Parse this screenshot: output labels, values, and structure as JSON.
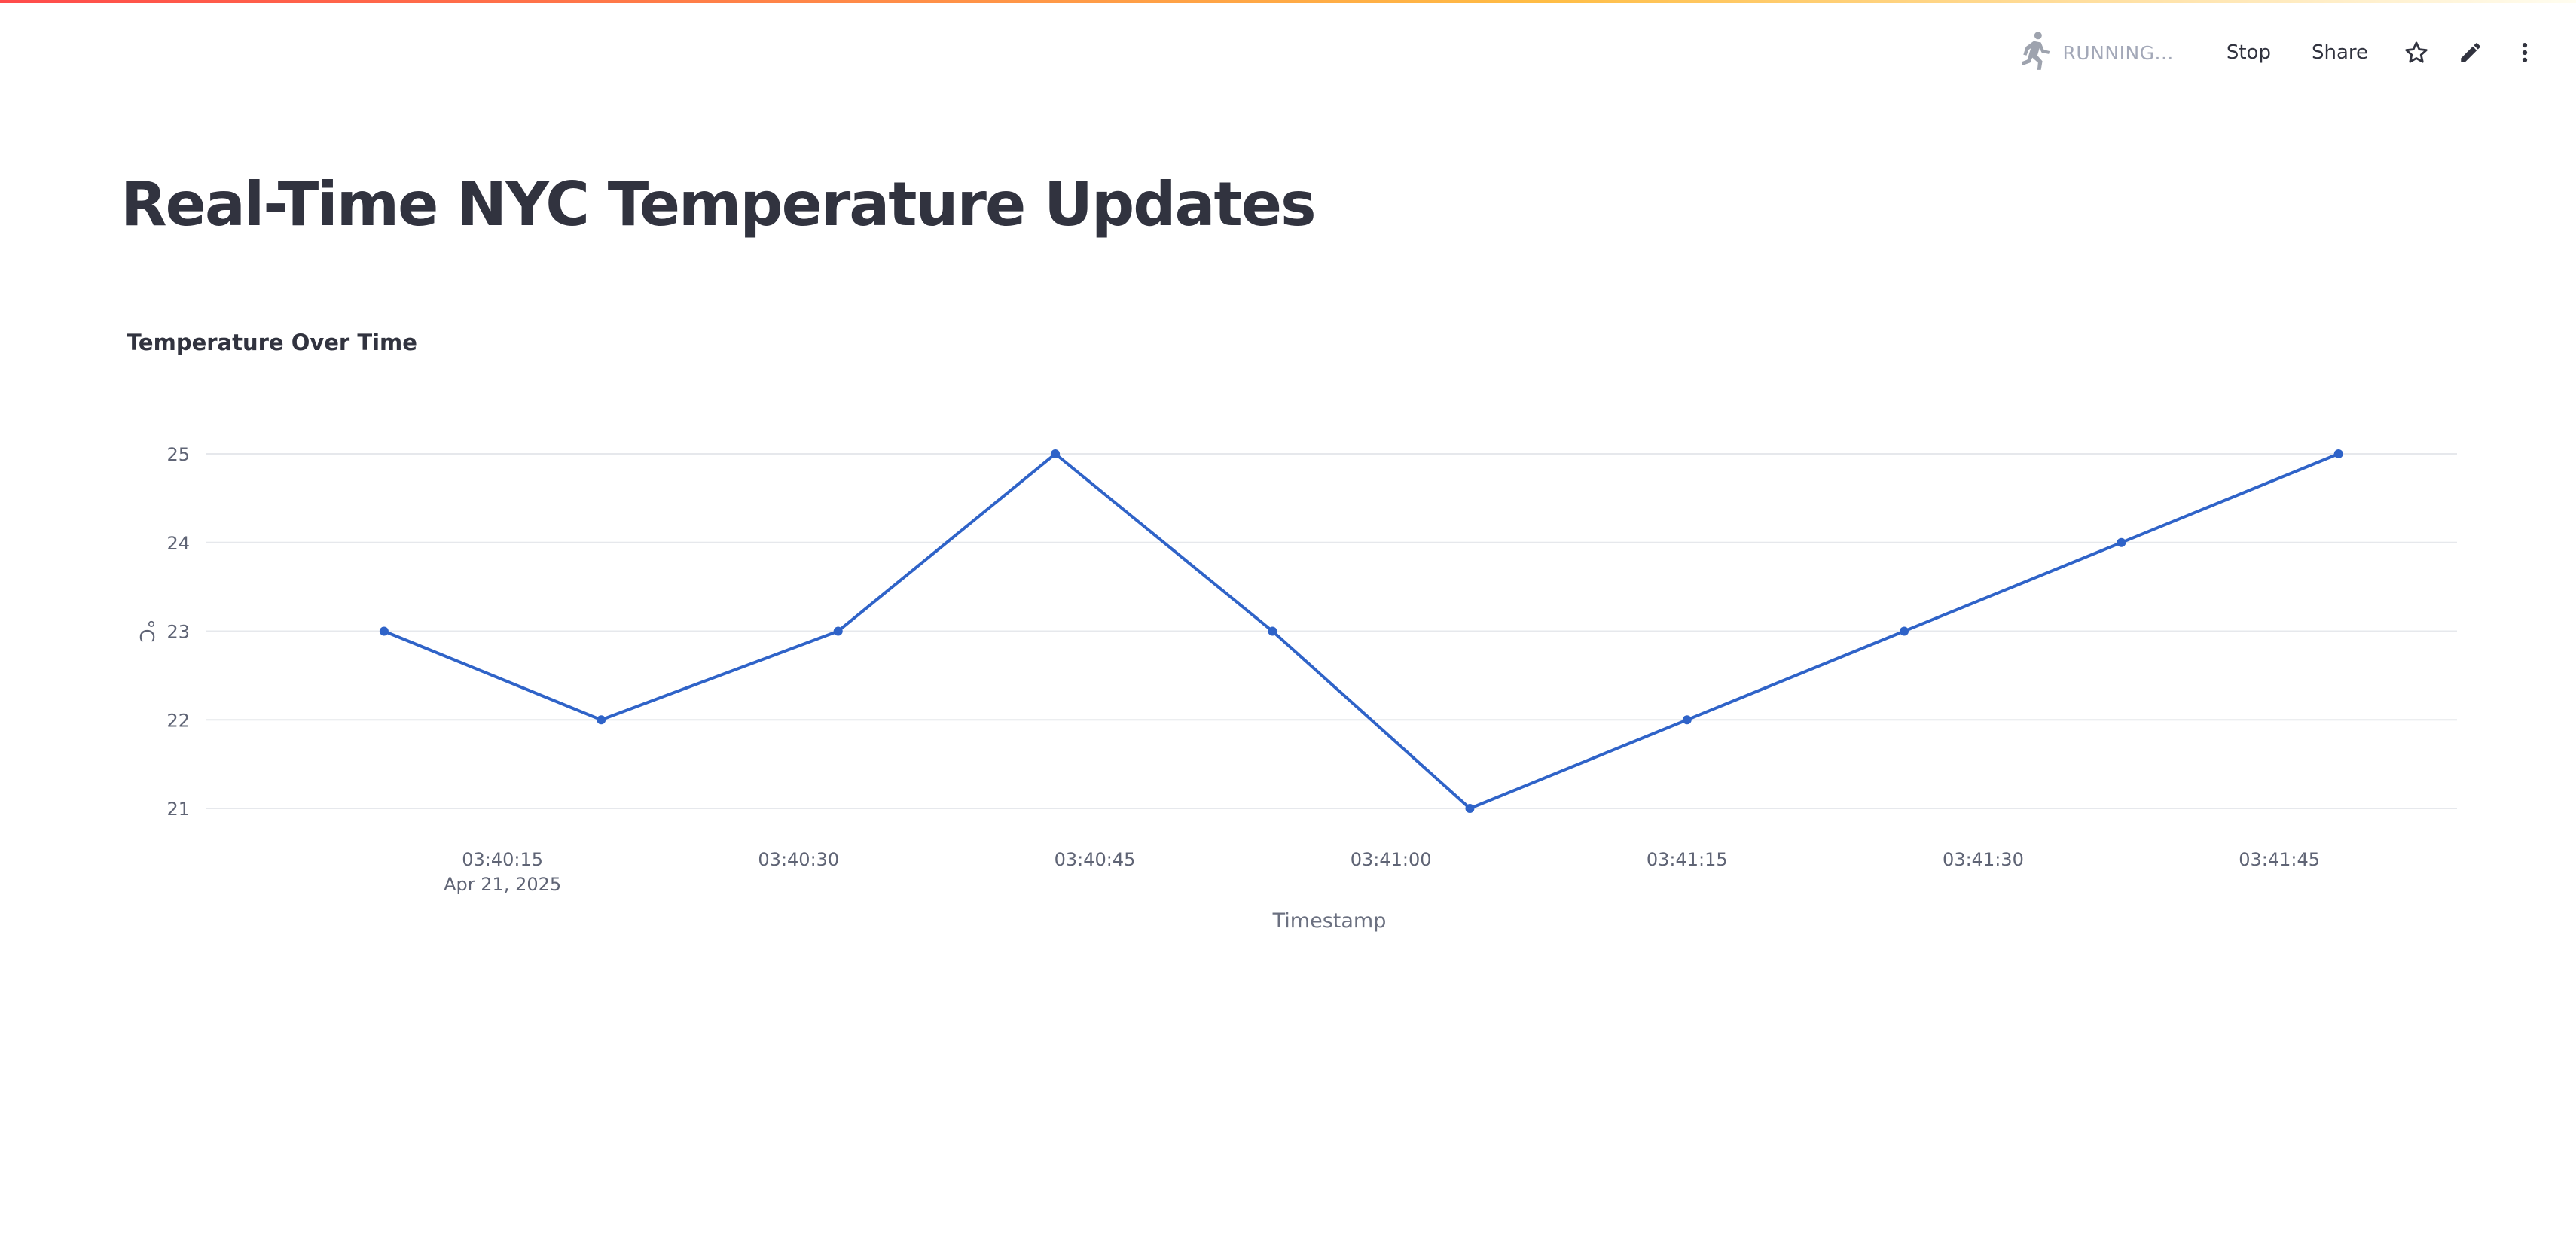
{
  "toolbar": {
    "status_label": "RUNNING...",
    "stop_label": "Stop",
    "share_label": "Share"
  },
  "page": {
    "title": "Real-Time NYC Temperature Updates"
  },
  "chart": {
    "title": "Temperature Over Time"
  },
  "colors": {
    "line": "#2f63c8",
    "grid": "#e6e8ec",
    "axis_text": "#5f6475"
  },
  "chart_data": {
    "type": "line",
    "title": "Temperature Over Time",
    "xlabel": "Timestamp",
    "ylabel": "°C",
    "grid": true,
    "x": [
      "2025-04-21 03:40:09",
      "2025-04-21 03:40:20",
      "2025-04-21 03:40:32",
      "2025-04-21 03:40:43",
      "2025-04-21 03:40:54",
      "2025-04-21 03:41:04",
      "2025-04-21 03:41:15",
      "2025-04-21 03:41:26",
      "2025-04-21 03:41:37",
      "2025-04-21 03:41:48"
    ],
    "series": [
      {
        "values": [
          23,
          22,
          23,
          25,
          23,
          21,
          22,
          23,
          24,
          25
        ]
      }
    ],
    "xlim": [
      "2025-04-21 03:40:00",
      "2025-04-21 03:41:54"
    ],
    "ylim": [
      21,
      25
    ],
    "yticks": [
      21,
      22,
      23,
      24,
      25
    ],
    "xtick_labels": [
      "03:40:15",
      "03:40:30",
      "03:40:45",
      "03:41:00",
      "03:41:15",
      "03:41:30",
      "03:41:45"
    ],
    "xtick_times": [
      "2025-04-21 03:40:15",
      "2025-04-21 03:40:30",
      "2025-04-21 03:40:45",
      "2025-04-21 03:41:00",
      "2025-04-21 03:41:15",
      "2025-04-21 03:41:30",
      "2025-04-21 03:41:45"
    ],
    "xtick_sublabel": "Apr 21, 2025"
  }
}
